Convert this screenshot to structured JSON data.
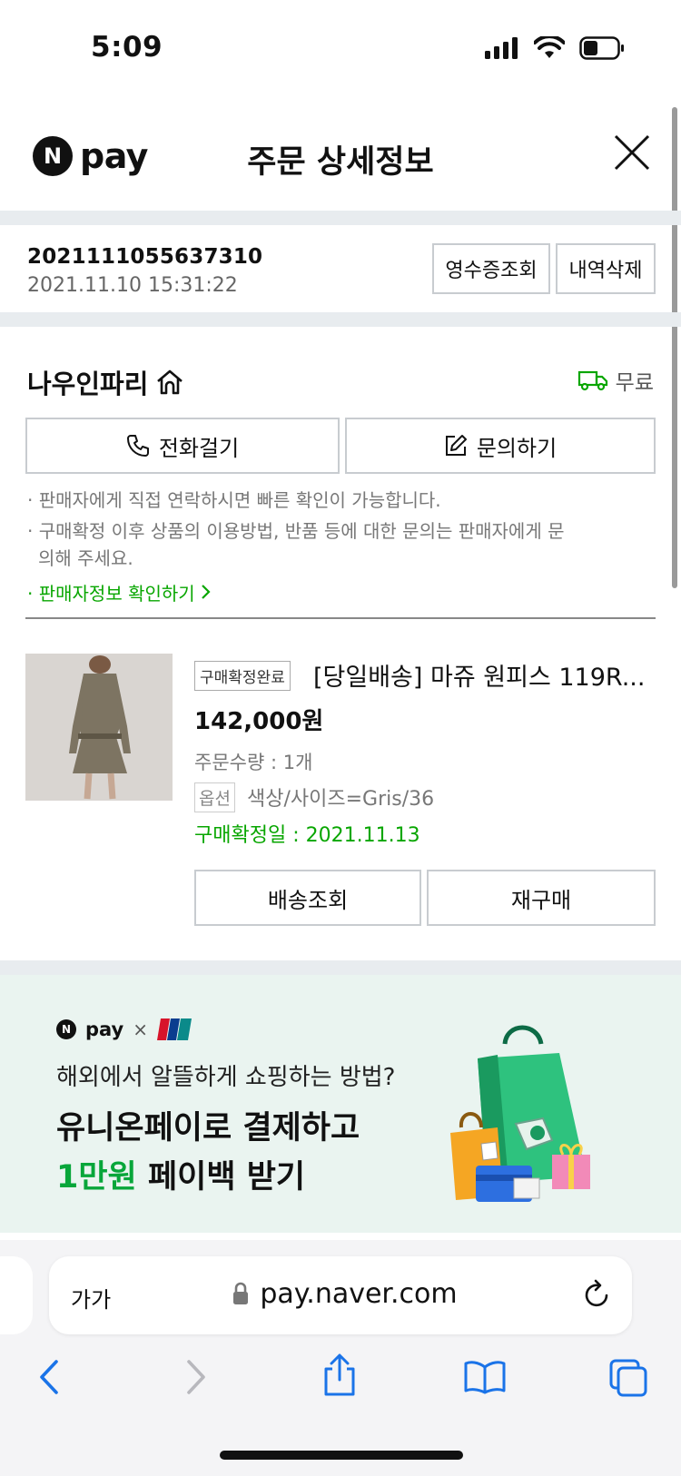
{
  "status": {
    "time": "5:09"
  },
  "header": {
    "logo_n": "N",
    "logo_pay": "pay",
    "title": "주문 상세정보"
  },
  "order": {
    "number": "2021111055637310",
    "datetime": "2021.11.10 15:31:22",
    "receipt_label": "영수증조회",
    "delete_label": "내역삭제"
  },
  "seller": {
    "name": "나우인파리",
    "shipping": "무료",
    "call_label": "전화걸기",
    "inquiry_label": "문의하기",
    "notice1": "· 판매자에게 직접 연락하시면 빠른 확인이 가능합니다.",
    "notice2a": "· 구매확정 이후 상품의 이용방법, 반품 등에 대한 문의는 판매자에게 문",
    "notice2b": "의해 주세요.",
    "info_link": "· 판매자정보 확인하기"
  },
  "product": {
    "status": "구매확정완료",
    "name": "[당일배송] 마쥬 원피스 119R...",
    "price": "142,000원",
    "quantity": "주문수량 : 1개",
    "option_tag": "옵션",
    "option_value": "색상/사이즈=Gris/36",
    "confirm_date": "구매확정일 : 2021.11.13",
    "track_label": "배송조회",
    "rebuy_label": "재구매"
  },
  "banner": {
    "logo_n": "N",
    "logo_pay": "pay",
    "times": "×",
    "unionpay": "UnionPay",
    "line1": "해외에서 알뜰하게 쇼핑하는 방법?",
    "line2": "유니온페이로 결제하고",
    "line3_green": "1만원",
    "line3_rest": " 페이백 받기"
  },
  "browser": {
    "aa": "가가",
    "url": "pay.naver.com"
  },
  "colors": {
    "naver_green": "#08a600",
    "ios_blue": "#1a73e8"
  }
}
